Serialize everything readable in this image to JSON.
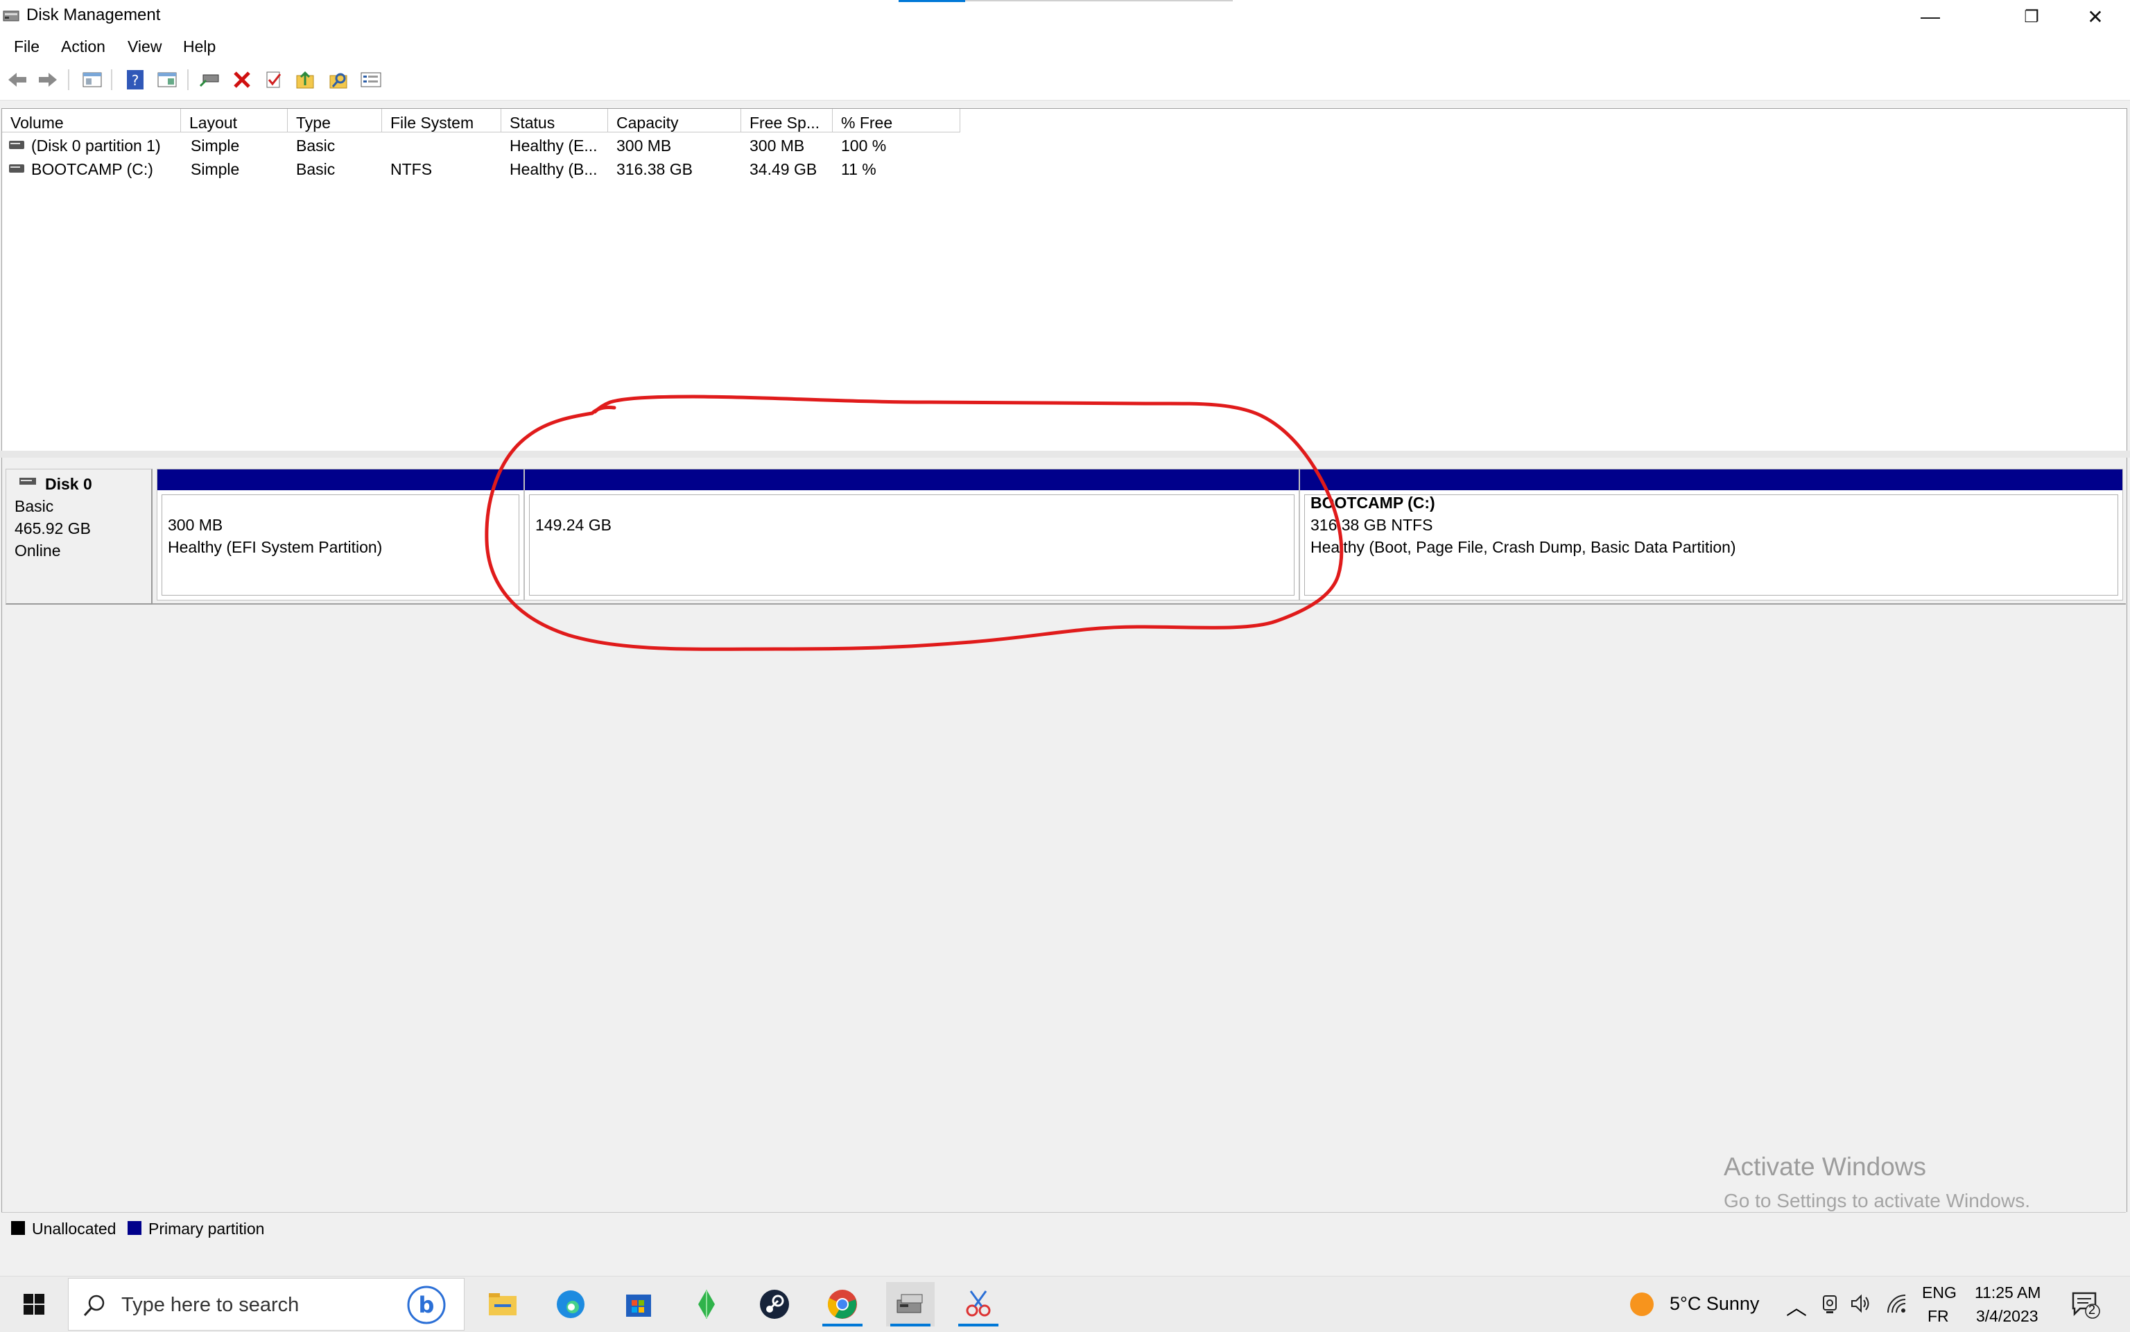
{
  "window": {
    "title": "Disk Management",
    "controls": {
      "minimize": "—",
      "restore": "❐",
      "close": "✕"
    }
  },
  "menu": [
    "File",
    "Action",
    "View",
    "Help"
  ],
  "toolbar": {
    "icons": [
      "back-icon",
      "forward-icon",
      "console-tree-icon",
      "help-icon",
      "properties-icon",
      "connect-icon",
      "delete-icon",
      "check-icon",
      "up-folder-icon",
      "search-folder-icon",
      "list-icon"
    ]
  },
  "volume_list": {
    "columns": [
      "Volume",
      "Layout",
      "Type",
      "File System",
      "Status",
      "Capacity",
      "Free Sp...",
      "% Free"
    ],
    "rows": [
      [
        "(Disk 0 partition 1)",
        "Simple",
        "Basic",
        "",
        "Healthy (E...",
        "300 MB",
        "300 MB",
        "100 %"
      ],
      [
        "BOOTCAMP (C:)",
        "Simple",
        "Basic",
        "NTFS",
        "Healthy (B...",
        "316.38 GB",
        "34.49 GB",
        "11 %"
      ]
    ]
  },
  "disk": {
    "name": "Disk 0",
    "type": "Basic",
    "size": "465.92 GB",
    "state": "Online"
  },
  "partitions": [
    {
      "title": "",
      "line1": "300 MB",
      "line2": "Healthy (EFI System Partition)"
    },
    {
      "title": "",
      "line1": "149.24 GB",
      "line2": ""
    },
    {
      "title": "BOOTCAMP  (C:)",
      "line1": "316.38 GB NTFS",
      "line2": "Healthy (Boot, Page File, Crash Dump, Basic Data Partition)"
    }
  ],
  "legend": [
    {
      "label": "Unallocated",
      "color": "#000000"
    },
    {
      "label": "Primary partition",
      "color": "#00008b"
    }
  ],
  "watermark": {
    "line1": "Activate Windows",
    "line2": "Go to Settings to activate Windows."
  },
  "taskbar": {
    "search_placeholder": "Type here to search",
    "apps": [
      "file-explorer-icon",
      "edge-icon",
      "store-icon",
      "sims-icon",
      "steam-icon",
      "chrome-icon",
      "disk-management-icon",
      "snipping-tool-icon"
    ],
    "weather": "5°C  Sunny",
    "lang1": "ENG",
    "lang2": "FR",
    "time": "11:25 AM",
    "date": "3/4/2023",
    "notifications": "2"
  },
  "colors": {
    "primary_partition": "#00008b",
    "annotation": "#e01b1b",
    "accent": "#0078d7"
  }
}
